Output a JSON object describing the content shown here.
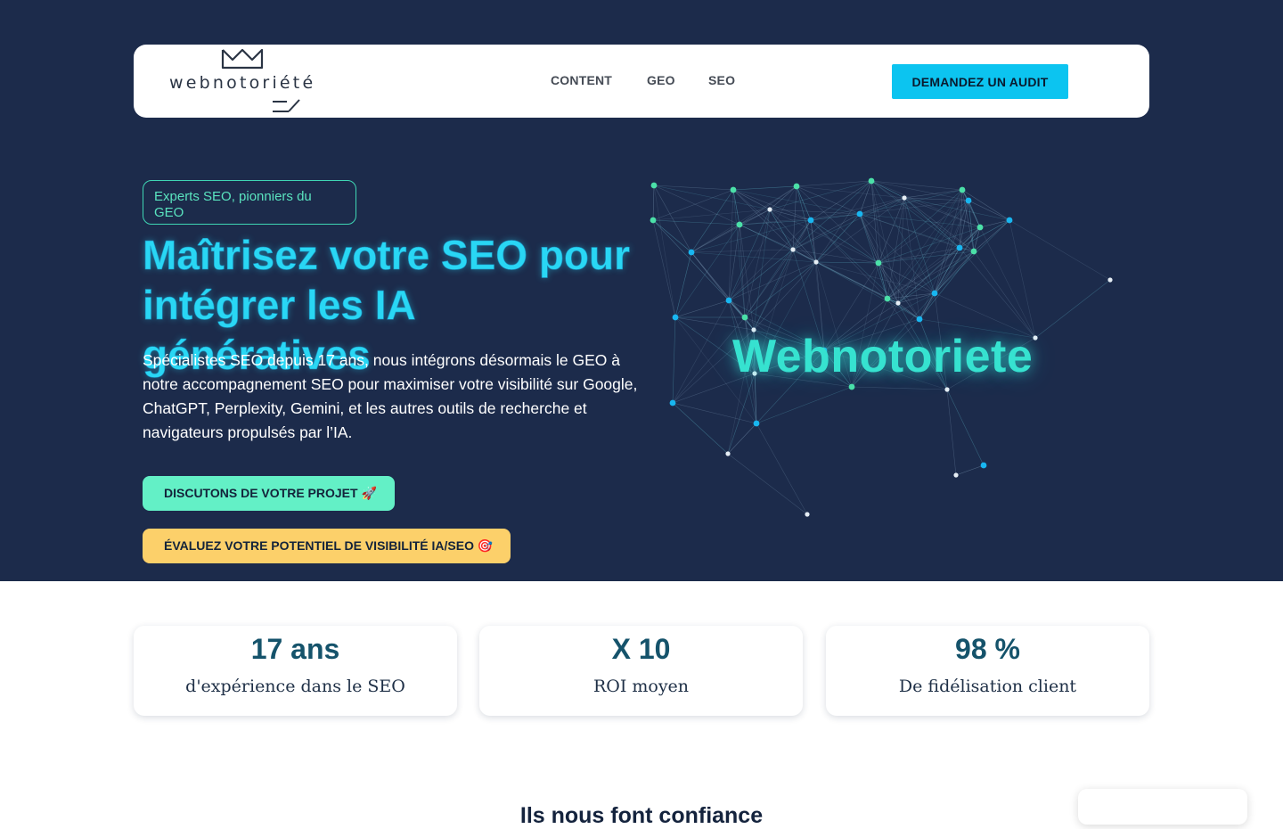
{
  "header": {
    "logo_text": "webnotoriété",
    "nav": [
      "CONTENT",
      "GEO",
      "SEO"
    ],
    "cta": "DEMANDEZ UN AUDIT"
  },
  "hero": {
    "badge": "Experts SEO, pionniers du GEO",
    "title": "Maîtrisez votre SEO pour intégrer les IA génératives",
    "description": "Spécialistes SEO depuis 17 ans, nous intégrons désormais le GEO à notre accompagnement SEO pour maximiser votre visibilité sur Google, ChatGPT, Perplexity, Gemini, et les autres outils de recherche et navigateurs propulsés par l’IA.",
    "btn_project": "DISCUTONS DE VOTRE PROJET 🚀",
    "btn_potential": "ÉVALUEZ VOTRE POTENTIEL DE VISIBILITÉ IA/SEO 🎯",
    "network_word": "Webnotoriete"
  },
  "stats": [
    {
      "value": "17 ans",
      "label": "d'expérience dans le SEO"
    },
    {
      "value": "X 10",
      "label": "ROI moyen"
    },
    {
      "value": "98 %",
      "label": "De fidélisation client"
    }
  ],
  "trust": {
    "title": "Ils nous font confiance"
  },
  "colors": {
    "hero_bg": "#1c2b4b",
    "accent_cyan": "#0cc4f0",
    "accent_green": "#63f0c6",
    "accent_yellow": "#fcd06a",
    "stat_value": "#15536b"
  },
  "icons": [
    "crown-logo-icon",
    "network-graph-illustration"
  ]
}
